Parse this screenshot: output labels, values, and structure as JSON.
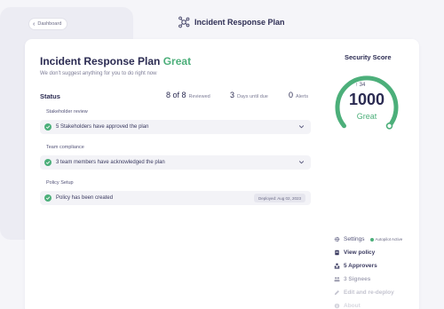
{
  "header": {
    "back_label": "Dashboard",
    "title": "Incident Response Plan"
  },
  "plan": {
    "title": "Incident Response Plan",
    "rating": "Great",
    "subtitle": "We don't suggest anything for you to do right now"
  },
  "status": {
    "label": "Status",
    "reviewed_count": "8 of 8",
    "reviewed_label": "Reviewed",
    "days_count": "3",
    "days_label": "Days until due",
    "alerts_count": "0",
    "alerts_label": "Alerts"
  },
  "sections": [
    {
      "label": "Stakeholder review",
      "item": "5 Stakeholders have approved the plan"
    },
    {
      "label": "Team compliance",
      "item": "3 team members have acknowledged the plan"
    },
    {
      "label": "Policy Setup",
      "item": "Policy has been created",
      "badge": "Deployed: Aug 02, 2023"
    }
  ],
  "score": {
    "title": "Security Score",
    "delta": "↑ 34",
    "value": "1000",
    "label": "Great",
    "fraction": 1.0
  },
  "menu": {
    "settings": "Settings",
    "autopilot": "Autopilot Active",
    "view_policy": "View policy",
    "approvers": "5 Approvers",
    "signees": "3 Signees",
    "edit": "Edit and re-deploy",
    "about": "About"
  },
  "colors": {
    "accent_green": "#4caf7a",
    "text_dark": "#2b2b52"
  }
}
